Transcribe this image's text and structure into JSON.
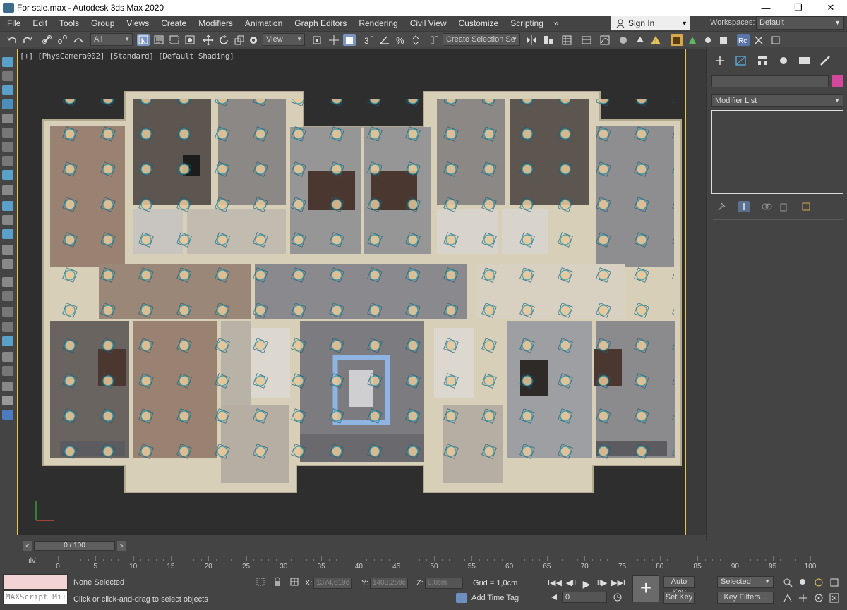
{
  "window": {
    "title": "For sale.max - Autodesk 3ds Max 2020",
    "minimize": "—",
    "restore": "❐",
    "close": "✕"
  },
  "menu": [
    "File",
    "Edit",
    "Tools",
    "Group",
    "Views",
    "Create",
    "Modifiers",
    "Animation",
    "Graph Editors",
    "Rendering",
    "Civil View",
    "Customize",
    "Scripting"
  ],
  "menu_more": "»",
  "signin": {
    "label": "Sign In"
  },
  "workspaces": {
    "label": "Workspaces:",
    "value": "Default"
  },
  "toolbar": {
    "filter": "All",
    "coord_system": "View",
    "selection_set": "Create Selection Se"
  },
  "viewport": {
    "label": "[+] [PhysCamera002] [Standard] [Default Shading]"
  },
  "command_panel": {
    "modifier_list": "Modifier List"
  },
  "timeline": {
    "prev": "<",
    "next": ">",
    "slider": "0 / 100",
    "ruler": [
      "0",
      "5",
      "10",
      "15",
      "20",
      "25",
      "30",
      "35",
      "40",
      "45",
      "50",
      "55",
      "60",
      "65",
      "70",
      "75",
      "80",
      "85",
      "90",
      "95",
      "100"
    ]
  },
  "status": {
    "maxscript": "MAXScript Mi:",
    "selected": "None Selected",
    "prompt": "Click or click-and-drag to select objects",
    "x_label": "X:",
    "x_value": "1374,619c",
    "y_label": "Y:",
    "y_value": "1403,259c",
    "z_label": "Z:",
    "z_value": "0,0cm",
    "grid": "Grid = 1,0cm",
    "add_time_tag": "Add Time Tag",
    "frame": "0",
    "auto_key": "Auto Key",
    "set_key": "Set Key",
    "selected_set": "Selected",
    "key_filters": "Key Filters..."
  },
  "colors": {
    "viewport_border": "#e2c65a",
    "object_color": "#d4489b"
  }
}
